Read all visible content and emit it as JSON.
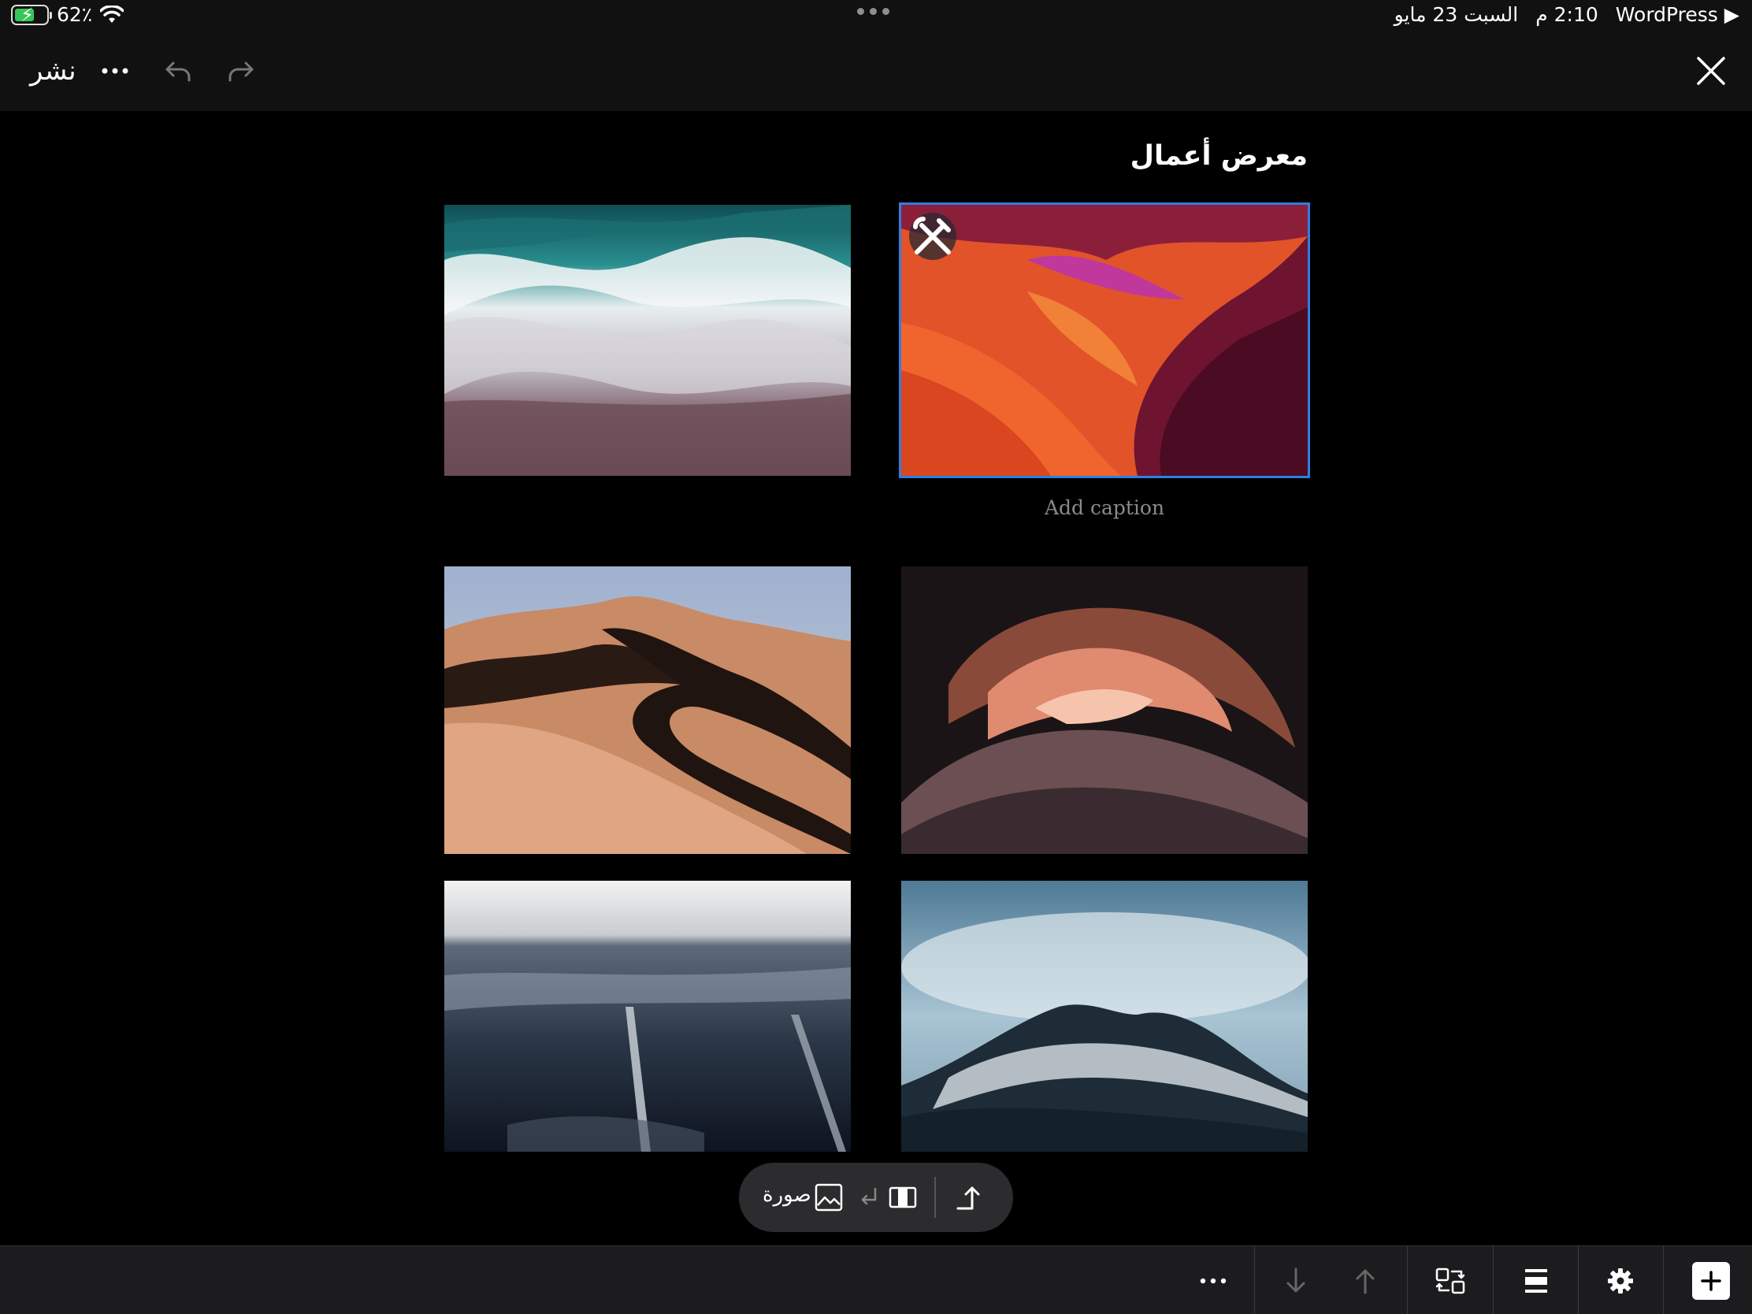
{
  "status_bar": {
    "battery": "62٪",
    "battery_level": 0.62,
    "app": "WordPress ▶",
    "time": "2:10 م",
    "date": "السبت 23 مايو"
  },
  "header": {
    "publish_label": "نشر"
  },
  "gallery": {
    "title": "معرض أعمال",
    "caption_placeholder": "Add caption"
  },
  "block_toolbar": {
    "block_label": "صورة"
  },
  "colors": {
    "selection": "#2f7fe0",
    "background": "#000000",
    "bar": "#111111"
  }
}
